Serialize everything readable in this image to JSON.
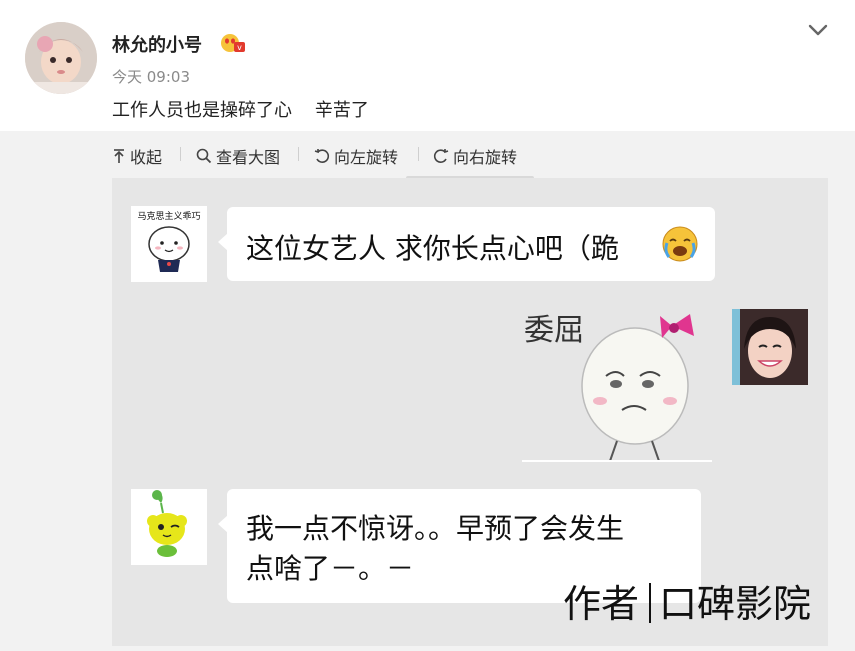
{
  "post": {
    "username": "林允的小号",
    "timestamp": "今天 09:03",
    "text": "工作人员也是操碎了心    辛苦了"
  },
  "toolbar": {
    "collapse_label": "收起",
    "view_large_label": "查看大图",
    "rotate_left_label": "向左旋转",
    "rotate_right_label": "向右旋转"
  },
  "chat": {
    "message1": {
      "sender_tag": "马克思主义乖巧",
      "text": "这位女艺人 求你长点心吧（跪"
    },
    "sticker": {
      "caption": "委屈"
    },
    "message2": {
      "line1": "我一点不惊讶。。早预了会发生",
      "line2": "点啥了－。－"
    }
  },
  "watermark": {
    "left": "作者",
    "right": "口碑影院"
  },
  "colors": {
    "page_background": "#f2f2f2",
    "image_background": "#e6e6e6",
    "bubble": "#ffffff",
    "bow_pink": "#e0358f",
    "sprout_yellow": "#e6e61a"
  },
  "icons": [
    "vip-badge-icon",
    "chevron-down-icon",
    "collapse-arrow-icon",
    "magnifier-icon",
    "rotate-left-icon",
    "rotate-right-icon",
    "crying-emoji-icon"
  ]
}
